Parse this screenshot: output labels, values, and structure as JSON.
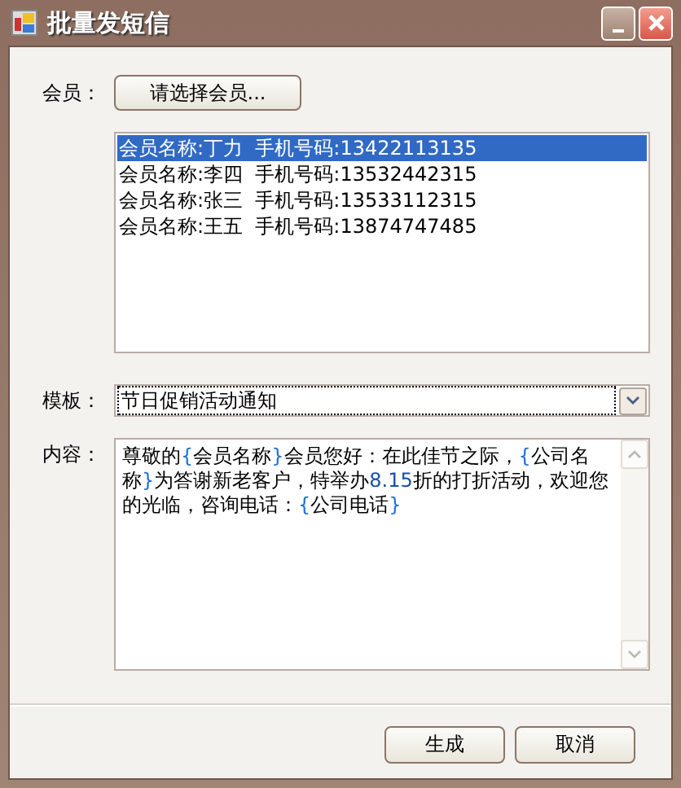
{
  "window": {
    "title": "批量发短信"
  },
  "member": {
    "label": "会员：",
    "button": "请选择会员..."
  },
  "members": [
    {
      "text": "会员名称:丁力  手机号码:13422113135",
      "selected": true
    },
    {
      "text": "会员名称:李四  手机号码:13532442315",
      "selected": false
    },
    {
      "text": "会员名称:张三  手机号码:13533112315",
      "selected": false
    },
    {
      "text": "会员名称:王五  手机号码:13874747485",
      "selected": false
    }
  ],
  "template": {
    "label": "模板：",
    "value": "节日促销活动通知"
  },
  "content": {
    "label": "内容：",
    "segments": [
      {
        "kind": "text",
        "text": "尊敬的"
      },
      {
        "kind": "brace",
        "text": "{"
      },
      {
        "kind": "text",
        "text": "会员名称"
      },
      {
        "kind": "brace",
        "text": "}"
      },
      {
        "kind": "text",
        "text": "会员您好：在此佳节之际，"
      },
      {
        "kind": "brace",
        "text": "{"
      },
      {
        "kind": "text",
        "text": "公司名称"
      },
      {
        "kind": "brace",
        "text": "}"
      },
      {
        "kind": "text",
        "text": "为答谢新老客户，特举办"
      },
      {
        "kind": "number",
        "text": "8.15"
      },
      {
        "kind": "text",
        "text": "折的打折活动，欢迎您的光临，咨询电话："
      },
      {
        "kind": "brace",
        "text": "{"
      },
      {
        "kind": "text",
        "text": "公司电话"
      },
      {
        "kind": "brace",
        "text": "}"
      }
    ]
  },
  "buttons": [
    "生成",
    "取消"
  ]
}
